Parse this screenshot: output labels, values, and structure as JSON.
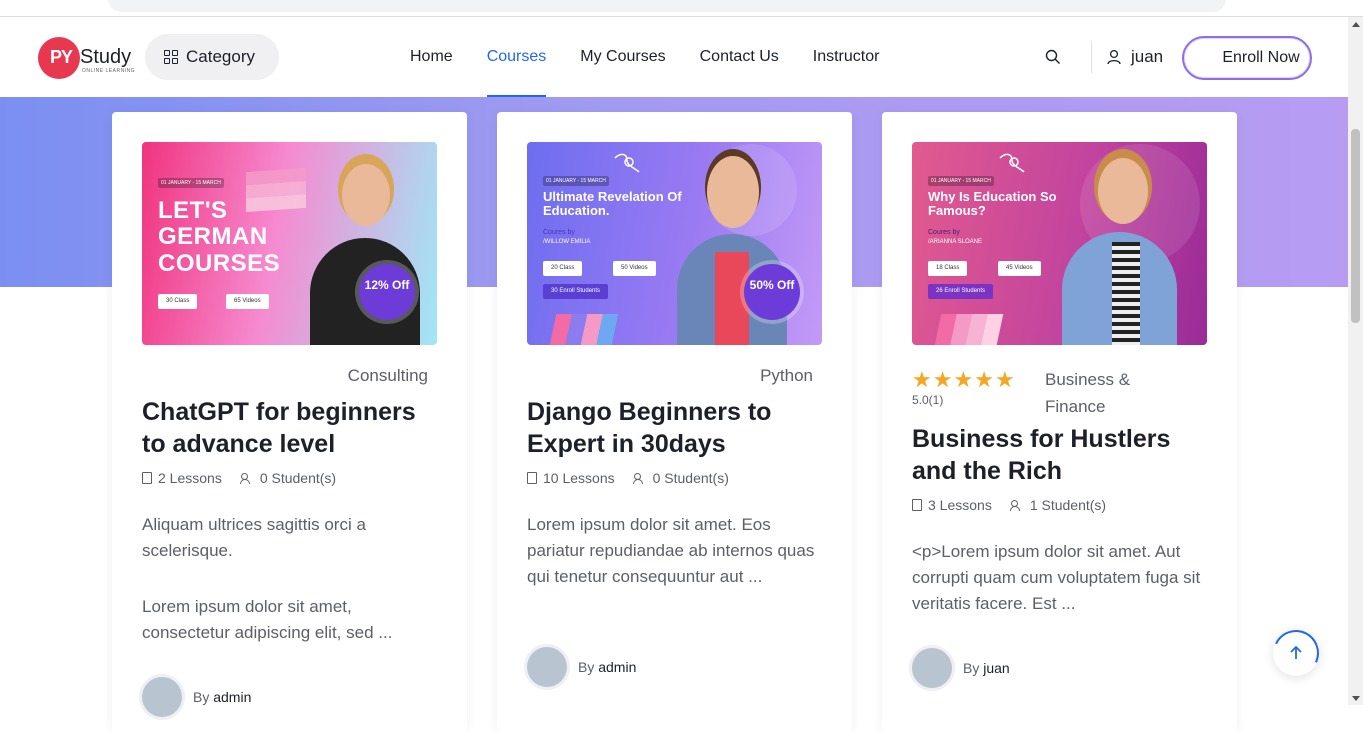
{
  "header": {
    "logo_prefix": "PY",
    "logo_name": "Study",
    "logo_tagline": "ONLINE LEARNING",
    "category_label": "Category",
    "nav": [
      "Home",
      "Courses",
      "My Courses",
      "Contact Us",
      "Instructor"
    ],
    "active_nav": "Courses",
    "username": "juan",
    "enroll_label": "Enroll Now"
  },
  "colors": {
    "accent": "#2467ec",
    "hero_band": "#a39bf1",
    "star": "#f5a623"
  },
  "courses": [
    {
      "thumb": {
        "date": "01 JANUARY - 15 MARCH",
        "headline": "LET'S GERMAN COURSES",
        "chips": [
          "30 Class",
          "65 Videos"
        ],
        "discount": "12% Off"
      },
      "category": "Consulting",
      "title": "ChatGPT for beginners to advance level",
      "lessons": "2 Lessons",
      "students": "0 Student(s)",
      "desc_1": "Aliquam ultrices sagittis orci a scelerisque.",
      "desc_2": "Lorem ipsum dolor sit amet, consectetur adipiscing elit, sed ...",
      "by": "By",
      "author": "admin"
    },
    {
      "thumb": {
        "date": "01 JANUARY - 15 MARCH",
        "headline": "Ultimate Revelation Of Education.",
        "course_by": "Coures by",
        "teacher": "/WILLOW EMILIA",
        "chips": [
          "20 Class",
          "50 Videos"
        ],
        "enrolled": "30 Enroll Students",
        "discount": "50% Off"
      },
      "category": "Python",
      "title": "Django Beginners to Expert in 30days",
      "lessons": "10 Lessons",
      "students": "0 Student(s)",
      "desc_1": "Lorem ipsum dolor sit amet. Eos pariatur repudiandae ab internos quas qui tenetur consequuntur aut ...",
      "by": "By",
      "author": "admin"
    },
    {
      "thumb": {
        "date": "01 JANUARY - 15 MARCH",
        "headline": "Why Is Education So Famous?",
        "course_by": "Coures by",
        "teacher": "/ARIANNA SLOANE",
        "chips": [
          "18 Class",
          "45 Videos"
        ],
        "enrolled": "26 Enroll Students"
      },
      "rating_value": 5.0,
      "rating_text": "5.0(1)",
      "category": "Business & Finance",
      "title": "Business for Hustlers and the Rich",
      "lessons": "3 Lessons",
      "students": "1 Student(s)",
      "desc_1": "<p>Lorem ipsum dolor sit amet. Aut corrupti quam cum voluptatem fuga sit veritatis facere. Est ...",
      "by": "By",
      "author": "juan"
    }
  ]
}
